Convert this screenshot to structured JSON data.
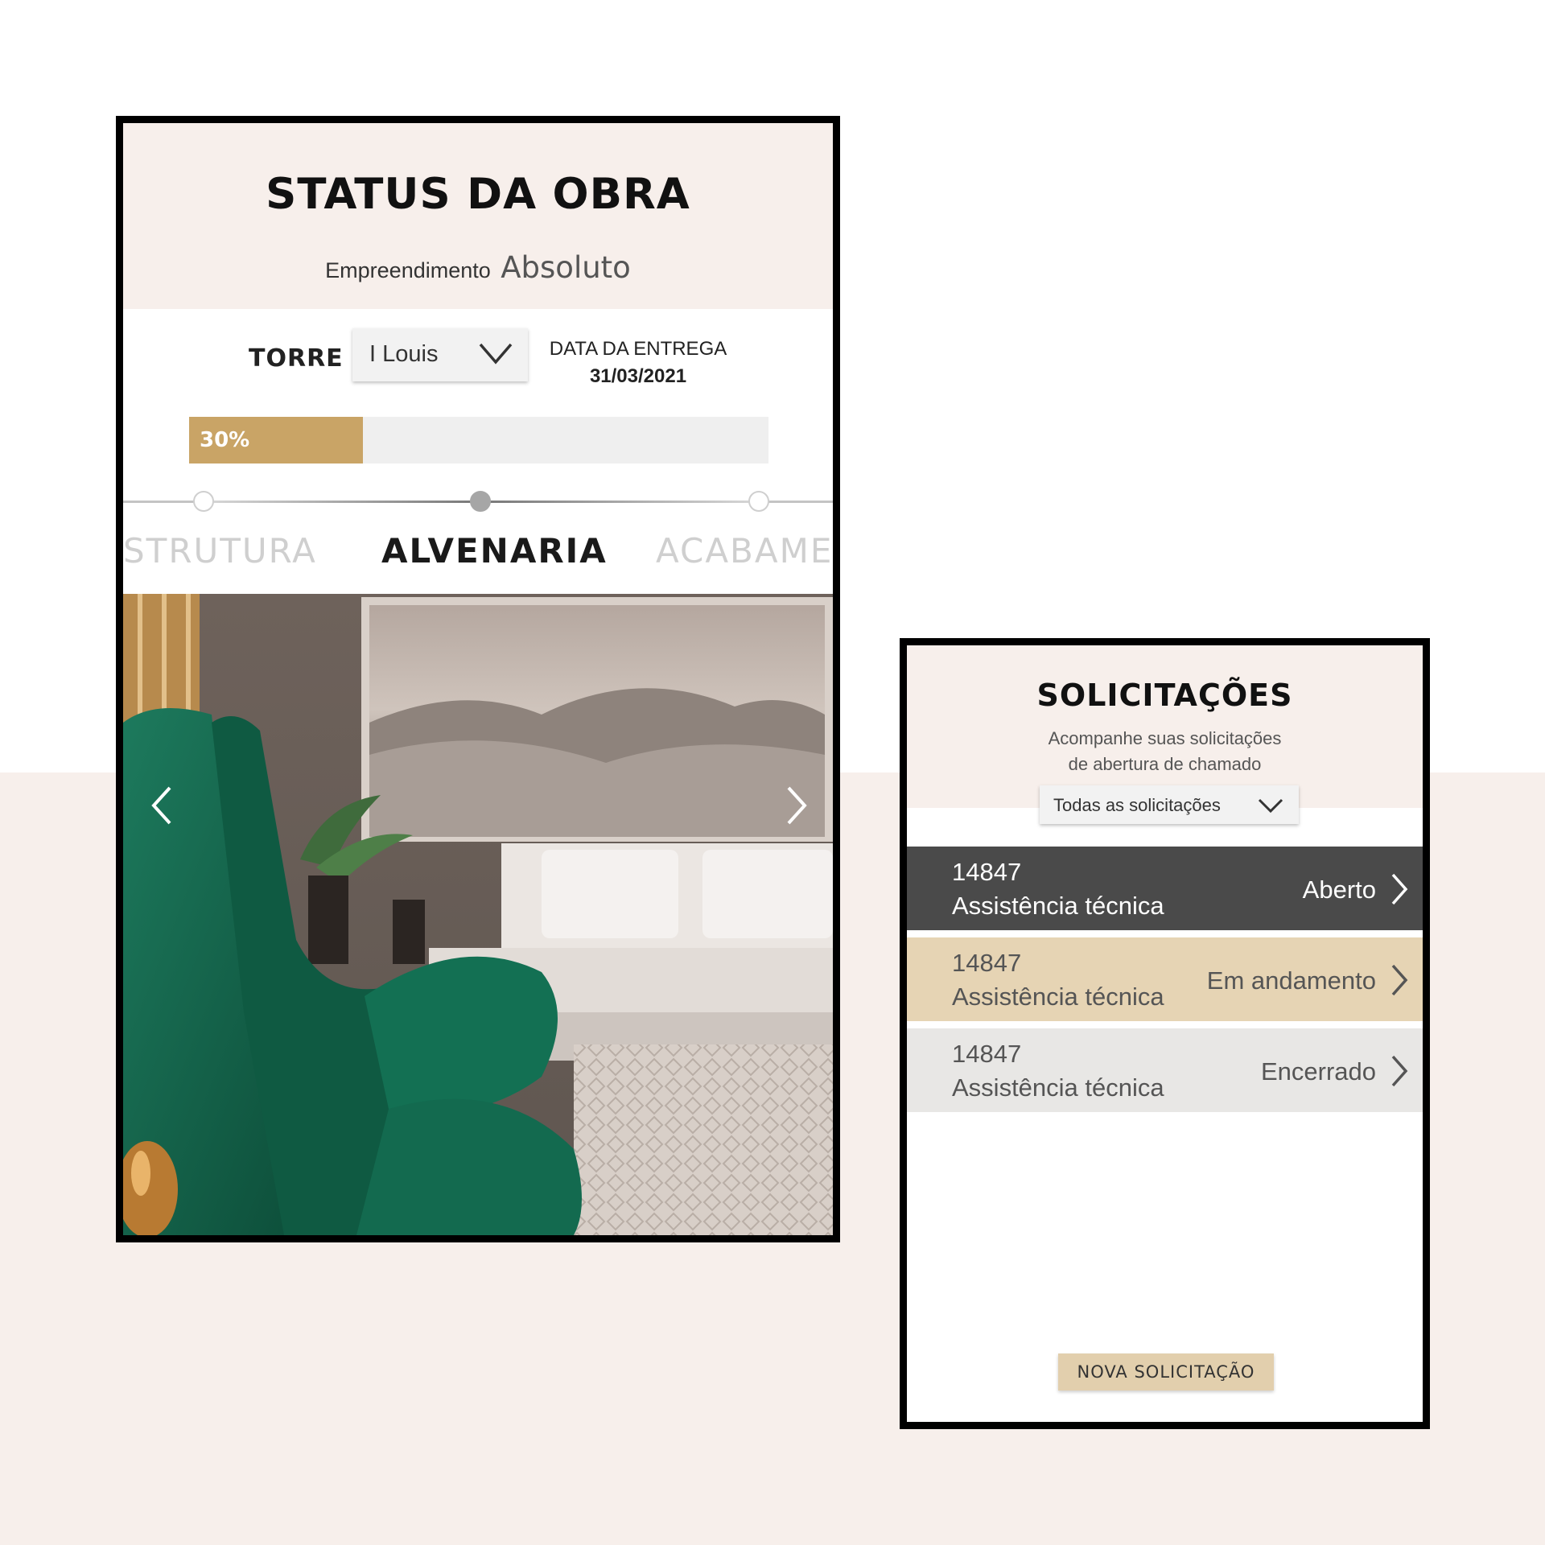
{
  "status_screen": {
    "title": "STATUS DA OBRA",
    "subtitle_prefix": "Empreendimento",
    "project_name": "Absoluto",
    "tower_label": "TORRE",
    "tower_selected": "I Louis",
    "delivery_label": "DATA DA ENTREGA",
    "delivery_date": "31/03/2021",
    "progress_value": 0.3,
    "progress_label": "30%",
    "stages": [
      {
        "label": "ESTRUTURA",
        "visible_text": "STRUTURA",
        "state": "done"
      },
      {
        "label": "ALVENARIA",
        "state": "current"
      },
      {
        "label": "ACABAMENTO",
        "visible_text": "ACABAMEN",
        "state": "upcoming"
      }
    ],
    "gallery_prev_icon": "chevron-left-icon",
    "gallery_next_icon": "chevron-right-icon"
  },
  "requests_screen": {
    "title": "SOLICITAÇÕES",
    "description_line1": "Acompanhe suas solicitações",
    "description_line2": "de abertura de chamado",
    "filter_selected": "Todas as solicitações",
    "requests": [
      {
        "number": "14847",
        "type": "Assistência técnica",
        "status": "Aberto",
        "bg": "#4a4a4a",
        "fg": "#ffffff"
      },
      {
        "number": "14847",
        "type": "Assistência técnica",
        "status": "Em andamento",
        "bg": "#e6d4b4",
        "fg": "#555555"
      },
      {
        "number": "14847",
        "type": "Assistência técnica",
        "status": "Encerrado",
        "bg": "#e8e7e5",
        "fg": "#555555"
      }
    ],
    "new_request_label": "NOVA SOLICITAÇÃO"
  },
  "colors": {
    "accent_gold": "#c9a466",
    "header_bg": "#f7efeb",
    "page_bg_bottom": "#f7efeb"
  }
}
